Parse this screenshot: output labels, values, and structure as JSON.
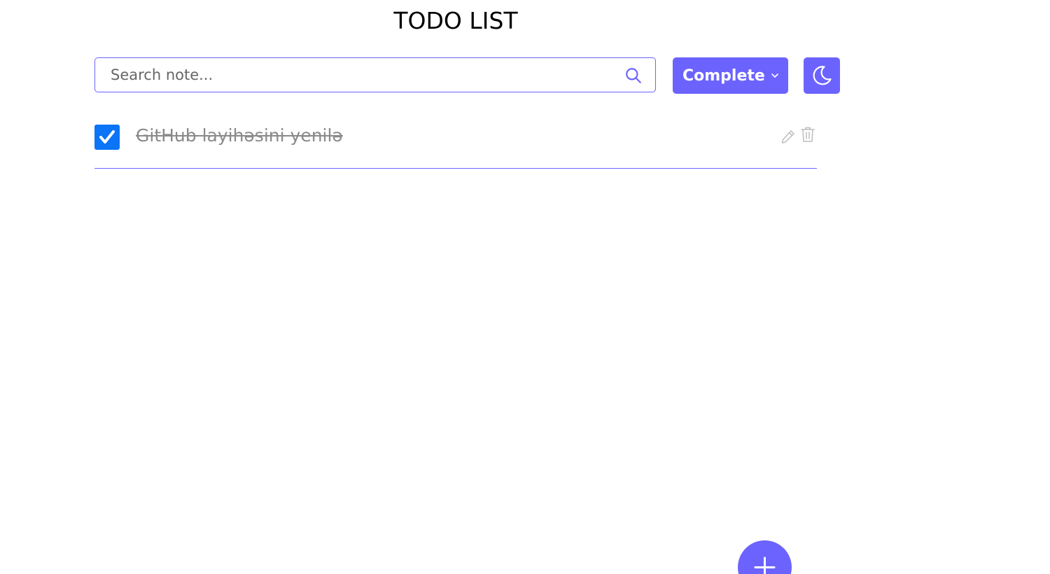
{
  "header": {
    "title": "TODO LIST"
  },
  "search": {
    "placeholder": "Search note...",
    "value": "",
    "icon": "search-icon"
  },
  "filter": {
    "selected": "Complete",
    "icon": "chevron-down-icon"
  },
  "theme_toggle": {
    "icon": "moon-icon"
  },
  "notes": [
    {
      "text": "GitHub layihəsini yenilə",
      "completed": true,
      "actions": [
        "pencil-icon",
        "trash-icon"
      ]
    }
  ],
  "add_button": {
    "icon": "plus-icon"
  },
  "colors": {
    "accent": "#6C63FF",
    "checkbox": "#0B74F7",
    "completed_text": "#8a8a8a",
    "background": "#ffffff"
  }
}
